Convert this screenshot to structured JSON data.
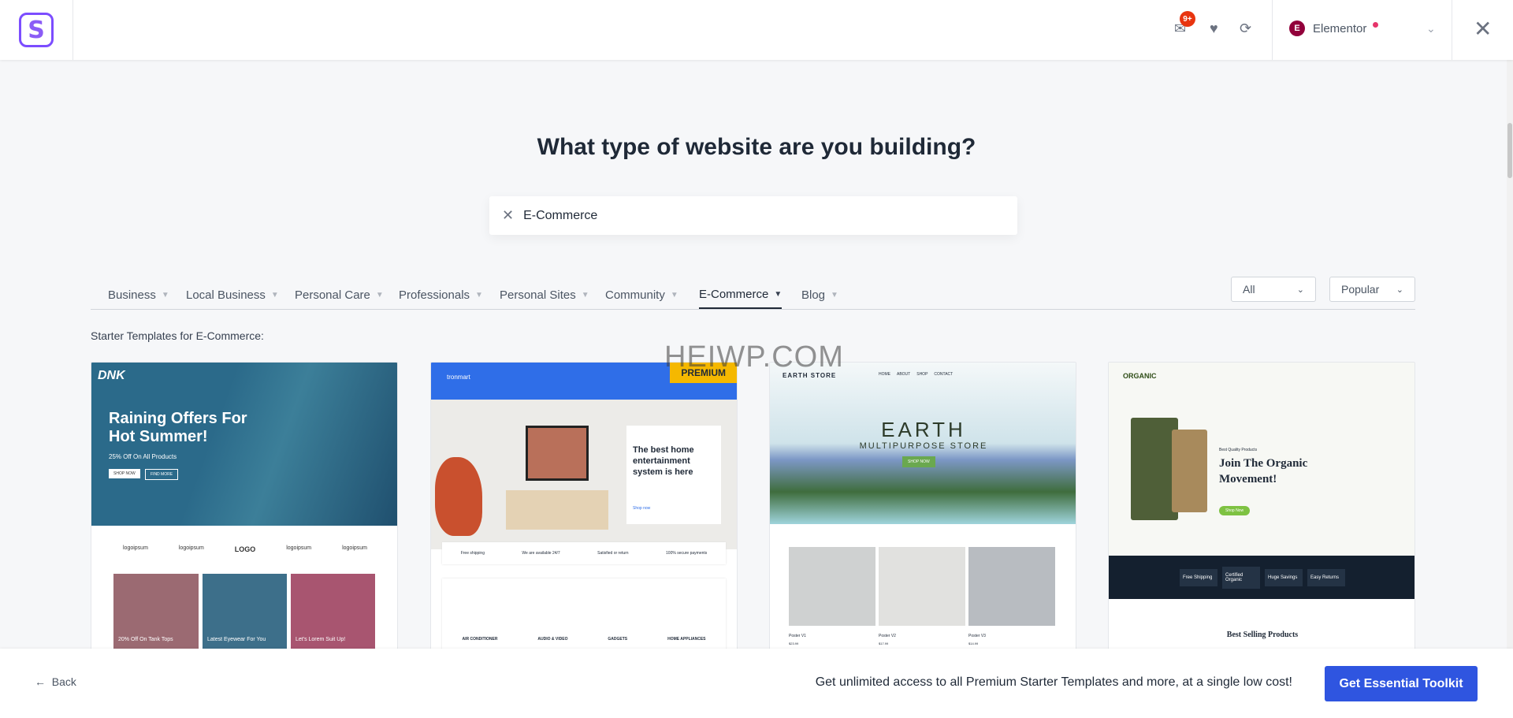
{
  "header": {
    "logo_letter": "S",
    "notifications_badge": "9+",
    "builder": "Elementor",
    "builder_icon_letter": "E",
    "icons": [
      "chat-icon",
      "heart-icon",
      "sync-icon",
      "chevron-down-icon",
      "close-icon"
    ]
  },
  "main": {
    "title": "What type of website are you building?",
    "search": {
      "value": "E-Commerce"
    },
    "categories": [
      {
        "label": "Business"
      },
      {
        "label": "Local Business"
      },
      {
        "label": "Personal Care"
      },
      {
        "label": "Professionals"
      },
      {
        "label": "Personal Sites"
      },
      {
        "label": "Community"
      },
      {
        "label": "E-Commerce",
        "active": true
      },
      {
        "label": "Blog"
      }
    ],
    "filter_type": "All",
    "sort": "Popular",
    "subtitle": "Starter Templates for E-Commerce:",
    "watermark": "HEIWP.COM",
    "templates": [
      {
        "brand": "DNK",
        "headline1": "Raining Offers For",
        "headline2": "Hot Summer!",
        "sub": "25% Off On All Products",
        "btn1": "SHOP NOW",
        "btn2": "FIND MORE",
        "logos": [
          "logoipsum",
          "logoipsum",
          "LOGO",
          "logoipsum",
          "logoipsum"
        ],
        "tiles": [
          "20% Off On Tank Tops",
          "Latest Eyewear For You",
          "Let's Lorem Suit Up!"
        ]
      },
      {
        "premium": "PREMIUM",
        "brand": "tronmart",
        "headline": "The best home entertainment system is here",
        "link": "Shop now",
        "features": [
          "Free shipping",
          "We are available 24/7",
          "Satisfied or return",
          "100% secure payments"
        ],
        "products": [
          "AIR CONDITIONER",
          "AUDIO & VIDEO",
          "GADGETS",
          "HOME APPLIANCES"
        ]
      },
      {
        "brand": "EARTH STORE",
        "nav": [
          "HOME",
          "ABOUT",
          "SHOP",
          "CONTACT"
        ],
        "headline": "EARTH",
        "sub": "MULTIPURPOSE STORE",
        "btn": "SHOP NOW",
        "posters": [
          {
            "name": "Poster V1",
            "price": "$23.99"
          },
          {
            "name": "Poster V2",
            "price": "$17.99"
          },
          {
            "name": "Poster V3",
            "price": "$14.99"
          }
        ]
      },
      {
        "brand": "ORGANIC",
        "kicker": "Best Quality Products",
        "headline1": "Join The Organic",
        "headline2": "Movement!",
        "btn": "Shop Now",
        "features": [
          "Free Shipping",
          "Certified Organic",
          "Huge Savings",
          "Easy Returns"
        ],
        "section": "Best Selling Products"
      }
    ]
  },
  "footer": {
    "back": "Back",
    "promo": "Get unlimited access to all Premium Starter Templates and more, at a single low cost!",
    "cta": "Get Essential Toolkit"
  },
  "colors": {
    "accent": "#2f55e0",
    "premium": "#f5b800",
    "badge": "#e8340f",
    "elementor": "#92003b"
  }
}
